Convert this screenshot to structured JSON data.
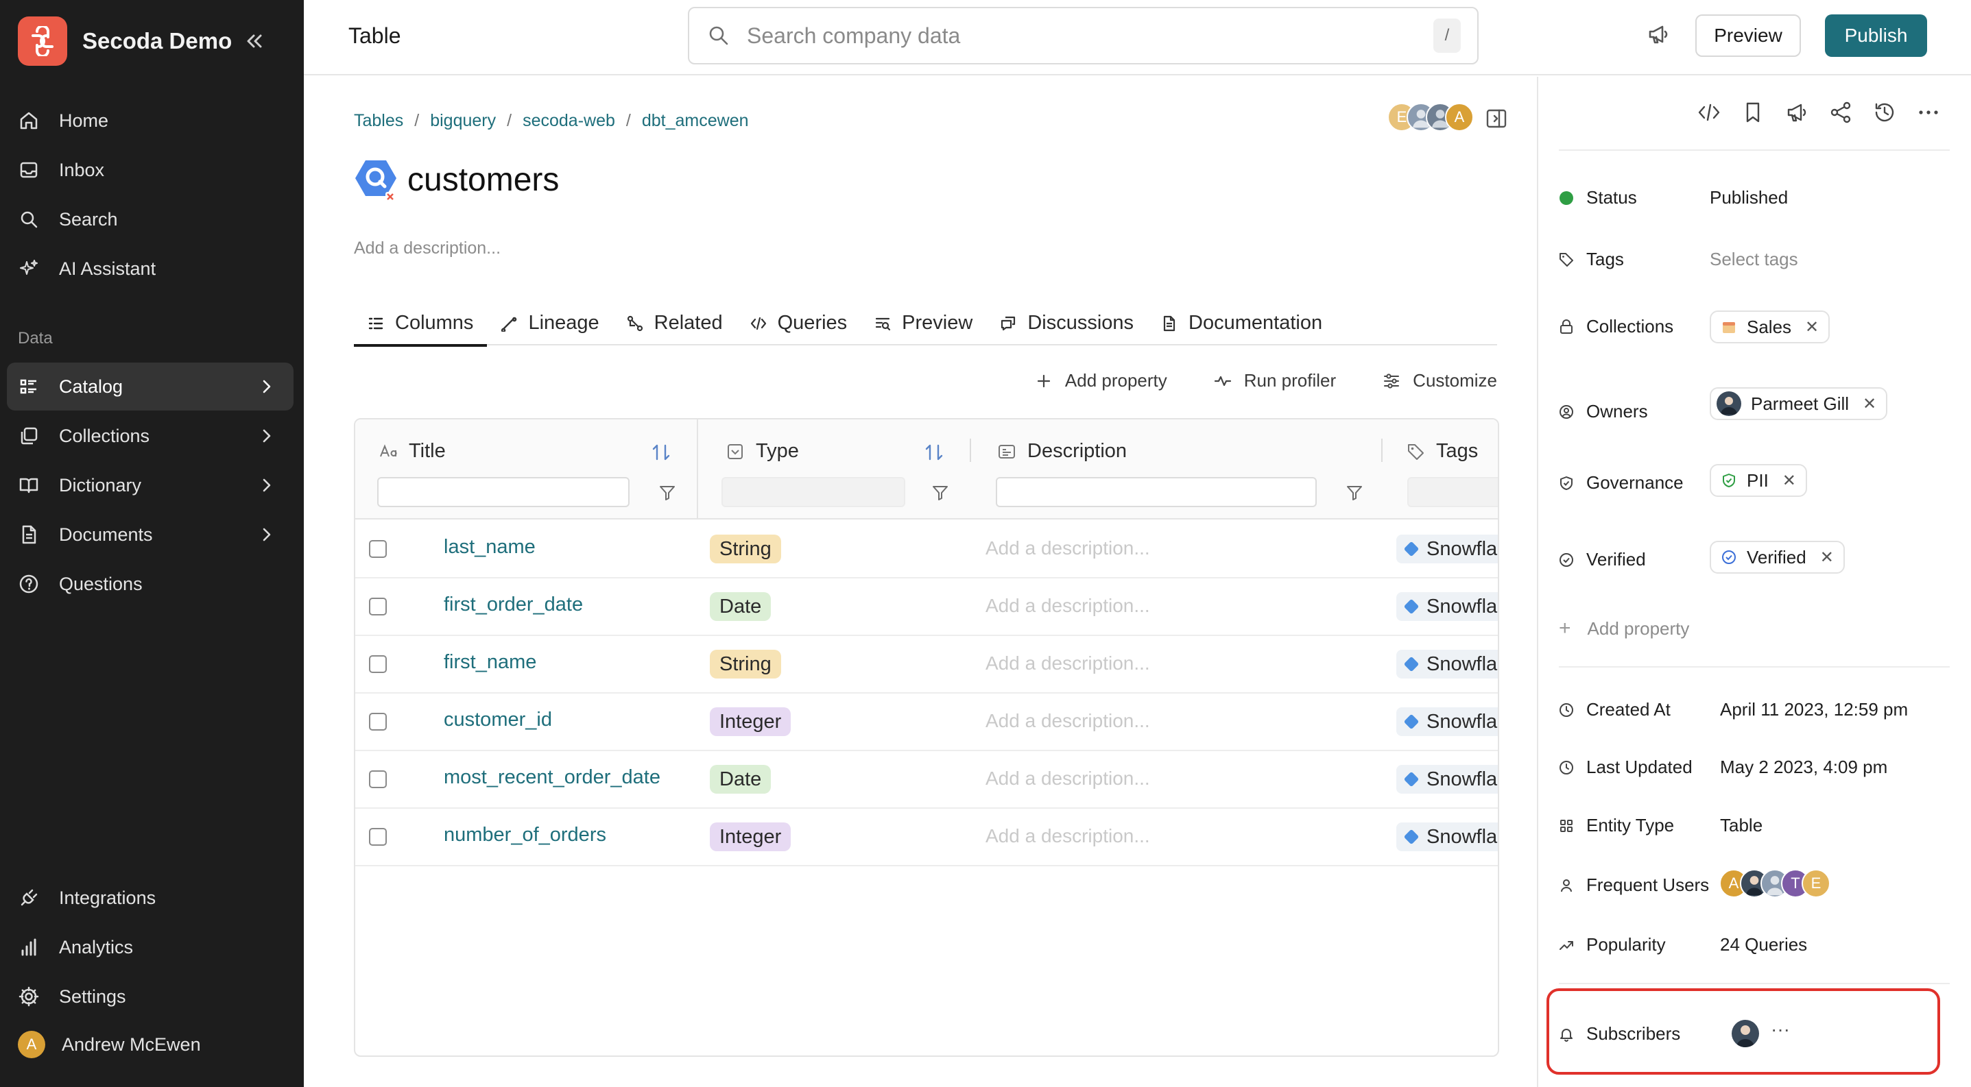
{
  "workspace": {
    "name": "Secoda Demo"
  },
  "sidebar": {
    "top_items": [
      {
        "label": "Home",
        "icon": "home-icon"
      },
      {
        "label": "Inbox",
        "icon": "inbox-icon"
      },
      {
        "label": "Search",
        "icon": "search-icon"
      },
      {
        "label": "AI Assistant",
        "icon": "sparkle-icon"
      }
    ],
    "section_label": "Data",
    "data_items": [
      {
        "label": "Catalog",
        "icon": "catalog-icon",
        "active": true
      },
      {
        "label": "Collections",
        "icon": "collections-icon"
      },
      {
        "label": "Dictionary",
        "icon": "book-icon"
      },
      {
        "label": "Documents",
        "icon": "document-icon"
      },
      {
        "label": "Questions",
        "icon": "question-icon"
      }
    ],
    "bottom_items": [
      {
        "label": "Integrations",
        "icon": "plug-icon"
      },
      {
        "label": "Analytics",
        "icon": "bar-chart-icon"
      },
      {
        "label": "Settings",
        "icon": "gear-icon"
      }
    ],
    "user": {
      "name": "Andrew McEwen",
      "initial": "A"
    }
  },
  "topbar": {
    "page_type": "Table",
    "search_placeholder": "Search company data",
    "search_shortcut": "/",
    "preview_label": "Preview",
    "publish_label": "Publish"
  },
  "breadcrumb": [
    "Tables",
    "bigquery",
    "secoda-web",
    "dbt_amcewen"
  ],
  "viewer_avatars": [
    "E",
    "",
    "",
    "A"
  ],
  "table": {
    "name": "customers",
    "description_placeholder": "Add a description..."
  },
  "tabs": [
    {
      "label": "Columns",
      "icon": "columns-icon",
      "active": true
    },
    {
      "label": "Lineage",
      "icon": "lineage-icon"
    },
    {
      "label": "Related",
      "icon": "related-icon"
    },
    {
      "label": "Queries",
      "icon": "code-icon"
    },
    {
      "label": "Preview",
      "icon": "preview-icon"
    },
    {
      "label": "Discussions",
      "icon": "discussion-icon"
    },
    {
      "label": "Documentation",
      "icon": "doc-icon"
    }
  ],
  "actions": {
    "add_property": "Add property",
    "run_profiler": "Run profiler",
    "customize": "Customize"
  },
  "grid": {
    "headers": {
      "title": "Title",
      "type": "Type",
      "description": "Description",
      "tags": "Tags"
    },
    "desc_placeholder": "Add a description...",
    "rows": [
      {
        "name": "last_name",
        "type": "String",
        "tag": "Snowflake"
      },
      {
        "name": "first_order_date",
        "type": "Date",
        "tag": "Snowflake"
      },
      {
        "name": "first_name",
        "type": "String",
        "tag": "Snowflake"
      },
      {
        "name": "customer_id",
        "type": "Integer",
        "tag": "Snowflake"
      },
      {
        "name": "most_recent_order_date",
        "type": "Date",
        "tag": "Snowflake"
      },
      {
        "name": "number_of_orders",
        "type": "Integer",
        "tag": "Snowflake"
      }
    ]
  },
  "properties": {
    "status": {
      "label": "Status",
      "value": "Published"
    },
    "tags": {
      "label": "Tags",
      "placeholder": "Select tags"
    },
    "collections": {
      "label": "Collections",
      "chip": "Sales"
    },
    "owners": {
      "label": "Owners",
      "chip": "Parmeet Gill"
    },
    "governance": {
      "label": "Governance",
      "chip": "PII"
    },
    "verified": {
      "label": "Verified",
      "chip": "Verified"
    },
    "add_property": "Add property",
    "created_at": {
      "label": "Created At",
      "value": "April 11 2023, 12:59 pm"
    },
    "last_updated": {
      "label": "Last Updated",
      "value": "May 2 2023, 4:09 pm"
    },
    "entity_type": {
      "label": "Entity Type",
      "value": "Table"
    },
    "frequent_users": {
      "label": "Frequent Users",
      "avatars": [
        "A",
        "",
        "",
        "T",
        "E"
      ]
    },
    "popularity": {
      "label": "Popularity",
      "value": "24 Queries"
    },
    "subscribers": {
      "label": "Subscribers",
      "more": "···"
    }
  },
  "colors": {
    "accent": "#1e6e7b",
    "sidebar_bg": "#1d1d1d",
    "status_green": "#2f9e44",
    "highlight_red": "#e0312b",
    "logo": "#ea5a47"
  }
}
